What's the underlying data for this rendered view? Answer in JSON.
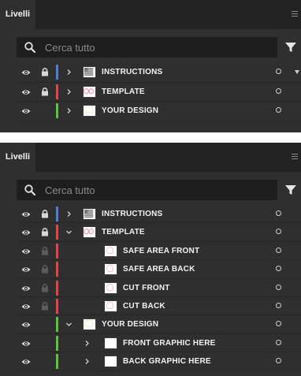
{
  "panels": [
    {
      "tab_label": "Livelli",
      "search_placeholder": "Cerca tutto",
      "rows": [
        {
          "name": "INSTRUCTIONS",
          "depth": 0,
          "lock": "locked",
          "chevron": "right",
          "color": "#4a7fd4",
          "thumb": "instructions"
        },
        {
          "name": "TEMPLATE",
          "depth": 0,
          "lock": "locked",
          "chevron": "right",
          "color": "#e04848",
          "thumb": "template"
        },
        {
          "name": "YOUR DESIGN",
          "depth": 0,
          "lock": "none",
          "chevron": "right",
          "color": "#5cc43c",
          "thumb": "design"
        }
      ]
    },
    {
      "tab_label": "Livelli",
      "search_placeholder": "Cerca tutto",
      "rows": [
        {
          "name": "INSTRUCTIONS",
          "depth": 0,
          "lock": "locked",
          "chevron": "right",
          "color": "#4a7fd4",
          "thumb": "instructions"
        },
        {
          "name": "TEMPLATE",
          "depth": 0,
          "lock": "locked",
          "chevron": "down",
          "color": "#e04848",
          "thumb": "template"
        },
        {
          "name": "SAFE AREA FRONT",
          "depth": 1,
          "lock": "inherited",
          "chevron": "none",
          "color": "#e04848",
          "thumb": "pink"
        },
        {
          "name": "SAFE AREA BACK",
          "depth": 1,
          "lock": "inherited",
          "chevron": "none",
          "color": "#e04848",
          "thumb": "pink"
        },
        {
          "name": "CUT FRONT",
          "depth": 1,
          "lock": "inherited",
          "chevron": "none",
          "color": "#e04848",
          "thumb": "pink"
        },
        {
          "name": "CUT BACK",
          "depth": 1,
          "lock": "inherited",
          "chevron": "none",
          "color": "#e04848",
          "thumb": "pink"
        },
        {
          "name": "YOUR DESIGN",
          "depth": 0,
          "lock": "none",
          "chevron": "down",
          "color": "#5cc43c",
          "thumb": "design"
        },
        {
          "name": "FRONT GRAPHIC HERE",
          "depth": 1,
          "lock": "none",
          "chevron": "right",
          "color": "#5cc43c",
          "thumb": "blank"
        },
        {
          "name": "BACK GRAPHIC HERE",
          "depth": 1,
          "lock": "none",
          "chevron": "right",
          "color": "#5cc43c",
          "thumb": "blank"
        }
      ]
    }
  ]
}
